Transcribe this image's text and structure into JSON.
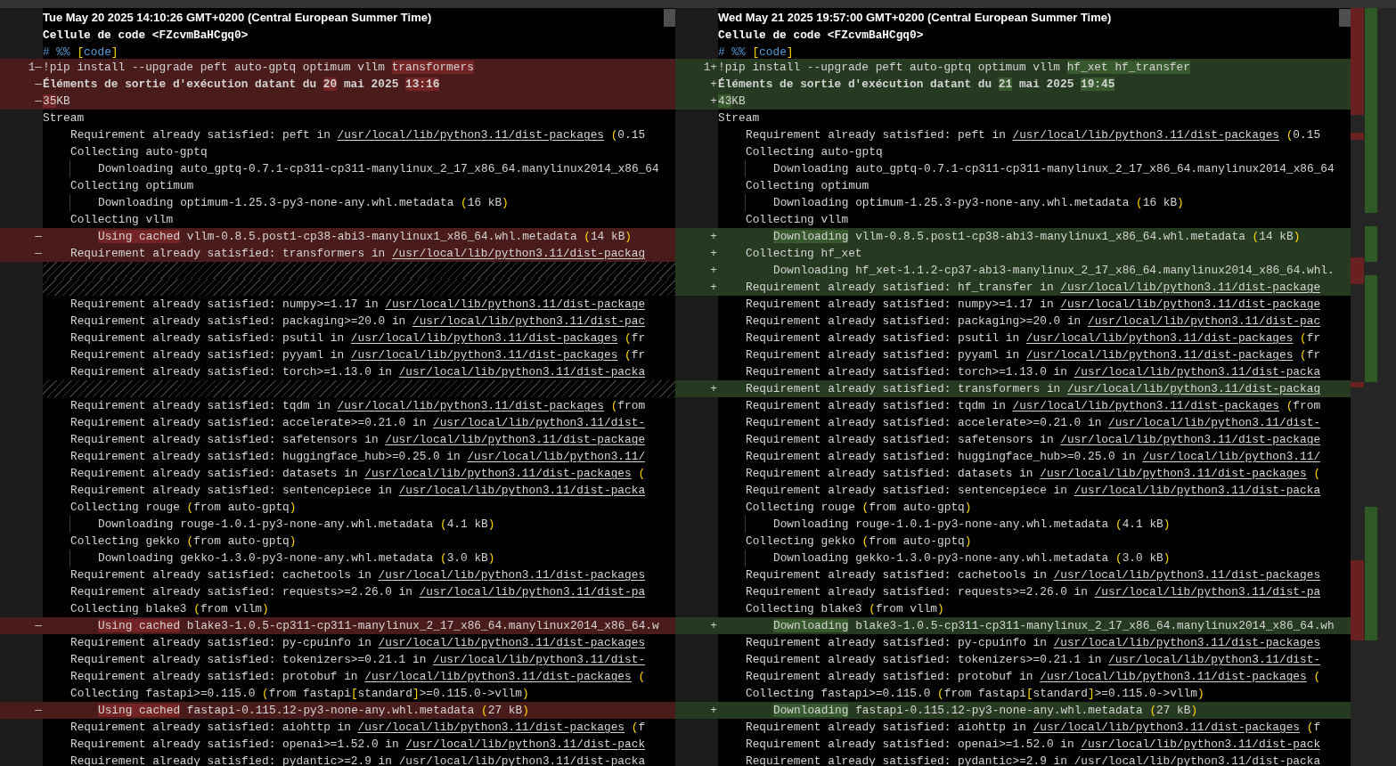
{
  "panes": [
    {
      "timestamp": "Tue May 20 2025 14:10:26 GMT+0200 (Central European Summer Time)",
      "cell_title": "Cellule de code <FZcvmBaHCgq0>",
      "cell_marker": [
        {
          "text": "# %% ",
          "kind": "keyword"
        },
        {
          "text": "[",
          "kind": "punct"
        },
        {
          "text": "code",
          "kind": "keyword"
        },
        {
          "text": "]",
          "kind": "punct"
        }
      ],
      "lines": [
        {
          "kind": "removed",
          "number": "1",
          "sign": "—",
          "segments": [
            {
              "text": "!pip install --upgrade peft auto-gptq optimum vllm "
            },
            {
              "text": "transformers",
              "kind": "changed"
            }
          ]
        },
        {
          "kind": "removed",
          "sign": "—",
          "bold": true,
          "segments": [
            {
              "text": "Éléments de sortie d'exécution datant du "
            },
            {
              "text": "20",
              "kind": "changed"
            },
            {
              "text": " mai 2025 "
            },
            {
              "text": "13:16",
              "kind": "changed"
            }
          ]
        },
        {
          "kind": "removed",
          "sign": "—",
          "segments": [
            {
              "text": "35",
              "kind": "changed"
            },
            {
              "text": "KB"
            }
          ]
        },
        {
          "kind": "context",
          "segments": [
            {
              "text": "Stream"
            }
          ],
          "children": [
            {
              "kind": "context",
              "segments": [
                {
                  "text": "Requirement already satisfied: peft in "
                },
                {
                  "text": "/usr/local/lib/python3.11/dist-packages",
                  "kind": "path"
                },
                {
                  "text": " (",
                  "kind": "punct"
                },
                {
                  "text": "0.15"
                }
              ]
            },
            {
              "kind": "context",
              "segments": [
                {
                  "text": "Collecting auto-gptq"
                }
              ],
              "children": [
                {
                  "kind": "context",
                  "segments": [
                    {
                      "text": "Downloading auto_gptq-0.7.1-cp311-cp311-manylinux_2_17_x86_64.manylinux2014_x86_64"
                    }
                  ]
                }
              ]
            },
            {
              "kind": "context",
              "segments": [
                {
                  "text": "Collecting optimum"
                }
              ],
              "children": [
                {
                  "kind": "context",
                  "segments": [
                    {
                      "text": "Downloading optimum-1.25.3-py3-none-any.whl.metadata "
                    },
                    {
                      "text": "(",
                      "kind": "punct"
                    },
                    {
                      "text": "16 kB"
                    },
                    {
                      "text": ")",
                      "kind": "punct"
                    }
                  ]
                }
              ]
            },
            {
              "kind": "context",
              "segments": [
                {
                  "text": "Collecting vllm"
                }
              ],
              "children": [
                {
                  "kind": "removed",
                  "sign": "—",
                  "segments": [
                    {
                      "text": "Using cached",
                      "kind": "changed"
                    },
                    {
                      "text": " vllm-0.8.5.post1-cp38-abi3-manylinux1_x86_64.whl.metadata "
                    },
                    {
                      "text": "(",
                      "kind": "punct"
                    },
                    {
                      "text": "14 kB"
                    },
                    {
                      "text": ")",
                      "kind": "punct"
                    }
                  ]
                }
              ]
            },
            {
              "kind": "removed",
              "sign": "—",
              "segments": [
                {
                  "text": "Requirement already satisfied: transformers in "
                },
                {
                  "text": "/usr/local/lib/python3.11/dist-packag",
                  "kind": "path"
                }
              ]
            },
            {
              "kind": "filler"
            },
            {
              "kind": "filler"
            },
            {
              "kind": "context",
              "segments": [
                {
                  "text": "Requirement already satisfied: numpy>=1.17 in "
                },
                {
                  "text": "/usr/local/lib/python3.11/dist-package",
                  "kind": "path"
                }
              ]
            },
            {
              "kind": "context",
              "segments": [
                {
                  "text": "Requirement already satisfied: packaging>=20.0 in "
                },
                {
                  "text": "/usr/local/lib/python3.11/dist-pac",
                  "kind": "path"
                }
              ]
            },
            {
              "kind": "context",
              "segments": [
                {
                  "text": "Requirement already satisfied: psutil in "
                },
                {
                  "text": "/usr/local/lib/python3.11/dist-packages",
                  "kind": "path"
                },
                {
                  "text": " (",
                  "kind": "punct"
                },
                {
                  "text": "fr"
                }
              ]
            },
            {
              "kind": "context",
              "segments": [
                {
                  "text": "Requirement already satisfied: pyyaml in "
                },
                {
                  "text": "/usr/local/lib/python3.11/dist-packages",
                  "kind": "path"
                },
                {
                  "text": " (",
                  "kind": "punct"
                },
                {
                  "text": "fr"
                }
              ]
            },
            {
              "kind": "context",
              "segments": [
                {
                  "text": "Requirement already satisfied: torch>=1.13.0 in "
                },
                {
                  "text": "/usr/local/lib/python3.11/dist-packa",
                  "kind": "path"
                }
              ]
            },
            {
              "kind": "filler"
            },
            {
              "kind": "context",
              "segments": [
                {
                  "text": "Requirement already satisfied: tqdm in "
                },
                {
                  "text": "/usr/local/lib/python3.11/dist-packages",
                  "kind": "path"
                },
                {
                  "text": " (",
                  "kind": "punct"
                },
                {
                  "text": "from"
                }
              ]
            },
            {
              "kind": "context",
              "segments": [
                {
                  "text": "Requirement already satisfied: accelerate>=0.21.0 in "
                },
                {
                  "text": "/usr/local/lib/python3.11/dist-",
                  "kind": "path"
                }
              ]
            },
            {
              "kind": "context",
              "segments": [
                {
                  "text": "Requirement already satisfied: safetensors in "
                },
                {
                  "text": "/usr/local/lib/python3.11/dist-package",
                  "kind": "path"
                }
              ]
            },
            {
              "kind": "context",
              "segments": [
                {
                  "text": "Requirement already satisfied: huggingface_hub>=0.25.0 in "
                },
                {
                  "text": "/usr/local/lib/python3.11/",
                  "kind": "path"
                }
              ]
            },
            {
              "kind": "context",
              "segments": [
                {
                  "text": "Requirement already satisfied: datasets in "
                },
                {
                  "text": "/usr/local/lib/python3.11/dist-packages",
                  "kind": "path"
                },
                {
                  "text": " (",
                  "kind": "punct"
                }
              ]
            },
            {
              "kind": "context",
              "segments": [
                {
                  "text": "Requirement already satisfied: sentencepiece in "
                },
                {
                  "text": "/usr/local/lib/python3.11/dist-packa",
                  "kind": "path"
                }
              ]
            },
            {
              "kind": "context",
              "segments": [
                {
                  "text": "Collecting rouge "
                },
                {
                  "text": "(",
                  "kind": "punct"
                },
                {
                  "text": "from auto-gptq"
                },
                {
                  "text": ")",
                  "kind": "punct"
                }
              ],
              "children": [
                {
                  "kind": "context",
                  "segments": [
                    {
                      "text": "Downloading rouge-1.0.1-py3-none-any.whl.metadata "
                    },
                    {
                      "text": "(",
                      "kind": "punct"
                    },
                    {
                      "text": "4.1 kB"
                    },
                    {
                      "text": ")",
                      "kind": "punct"
                    }
                  ]
                }
              ]
            },
            {
              "kind": "context",
              "segments": [
                {
                  "text": "Collecting gekko "
                },
                {
                  "text": "(",
                  "kind": "punct"
                },
                {
                  "text": "from auto-gptq"
                },
                {
                  "text": ")",
                  "kind": "punct"
                }
              ],
              "children": [
                {
                  "kind": "context",
                  "segments": [
                    {
                      "text": "Downloading gekko-1.3.0-py3-none-any.whl.metadata "
                    },
                    {
                      "text": "(",
                      "kind": "punct"
                    },
                    {
                      "text": "3.0 kB"
                    },
                    {
                      "text": ")",
                      "kind": "punct"
                    }
                  ]
                }
              ]
            },
            {
              "kind": "context",
              "segments": [
                {
                  "text": "Requirement already satisfied: cachetools in "
                },
                {
                  "text": "/usr/local/lib/python3.11/dist-packages",
                  "kind": "path"
                }
              ]
            },
            {
              "kind": "context",
              "segments": [
                {
                  "text": "Requirement already satisfied: requests>=2.26.0 in "
                },
                {
                  "text": "/usr/local/lib/python3.11/dist-pa",
                  "kind": "path"
                }
              ]
            },
            {
              "kind": "context",
              "segments": [
                {
                  "text": "Collecting blake3 "
                },
                {
                  "text": "(",
                  "kind": "punct"
                },
                {
                  "text": "from vllm"
                },
                {
                  "text": ")",
                  "kind": "punct"
                }
              ],
              "children": [
                {
                  "kind": "removed",
                  "sign": "—",
                  "segments": [
                    {
                      "text": "Using cached",
                      "kind": "changed"
                    },
                    {
                      "text": " blake3-1.0.5-cp311-cp311-manylinux_2_17_x86_64.manylinux2014_x86_64.w"
                    }
                  ]
                }
              ]
            },
            {
              "kind": "context",
              "segments": [
                {
                  "text": "Requirement already satisfied: py-cpuinfo in "
                },
                {
                  "text": "/usr/local/lib/python3.11/dist-packages",
                  "kind": "path"
                }
              ]
            },
            {
              "kind": "context",
              "segments": [
                {
                  "text": "Requirement already satisfied: tokenizers>=0.21.1 in "
                },
                {
                  "text": "/usr/local/lib/python3.11/dist-",
                  "kind": "path"
                }
              ]
            },
            {
              "kind": "context",
              "segments": [
                {
                  "text": "Requirement already satisfied: protobuf in "
                },
                {
                  "text": "/usr/local/lib/python3.11/dist-packages",
                  "kind": "path"
                },
                {
                  "text": " (",
                  "kind": "punct"
                }
              ]
            },
            {
              "kind": "context",
              "segments": [
                {
                  "text": "Collecting fastapi>=0.115.0 "
                },
                {
                  "text": "(",
                  "kind": "punct"
                },
                {
                  "text": "from fastapi"
                },
                {
                  "text": "[",
                  "kind": "punct"
                },
                {
                  "text": "standard"
                },
                {
                  "text": "]",
                  "kind": "punct"
                },
                {
                  "text": ">=0.115.0->vllm"
                },
                {
                  "text": ")",
                  "kind": "punct"
                }
              ],
              "children": [
                {
                  "kind": "removed",
                  "sign": "—",
                  "segments": [
                    {
                      "text": "Using cached",
                      "kind": "changed"
                    },
                    {
                      "text": " fastapi-0.115.12-py3-none-any.whl.metadata "
                    },
                    {
                      "text": "(",
                      "kind": "punct"
                    },
                    {
                      "text": "27 kB"
                    },
                    {
                      "text": ")",
                      "kind": "punct"
                    }
                  ]
                }
              ]
            },
            {
              "kind": "context",
              "segments": [
                {
                  "text": "Requirement already satisfied: aiohttp in "
                },
                {
                  "text": "/usr/local/lib/python3.11/dist-packages",
                  "kind": "path"
                },
                {
                  "text": " (",
                  "kind": "punct"
                },
                {
                  "text": "f"
                }
              ]
            },
            {
              "kind": "context",
              "segments": [
                {
                  "text": "Requirement already satisfied: openai>=1.52.0 in "
                },
                {
                  "text": "/usr/local/lib/python3.11/dist-pack",
                  "kind": "path"
                }
              ]
            },
            {
              "kind": "context",
              "segments": [
                {
                  "text": "Requirement already satisfied: pydantic>=2.9 in "
                },
                {
                  "text": "/usr/local/lib/python3.11/dist-packa",
                  "kind": "path"
                }
              ]
            }
          ]
        }
      ]
    },
    {
      "timestamp": "Wed May 21 2025 19:57:00 GMT+0200 (Central European Summer Time)",
      "cell_title": "Cellule de code <FZcvmBaHCgq0>",
      "cell_marker": [
        {
          "text": "# %% ",
          "kind": "keyword"
        },
        {
          "text": "[",
          "kind": "punct"
        },
        {
          "text": "code",
          "kind": "keyword"
        },
        {
          "text": "]",
          "kind": "punct"
        }
      ],
      "lines": [
        {
          "kind": "added",
          "number": "1",
          "sign": "+",
          "segments": [
            {
              "text": "!pip install --upgrade peft auto-gptq optimum vllm "
            },
            {
              "text": "hf_xet hf_transfer",
              "kind": "changed"
            }
          ]
        },
        {
          "kind": "added",
          "sign": "+",
          "bold": true,
          "segments": [
            {
              "text": "Éléments de sortie d'exécution datant du "
            },
            {
              "text": "21",
              "kind": "changed"
            },
            {
              "text": " mai 2025 "
            },
            {
              "text": "19:45",
              "kind": "changed"
            }
          ]
        },
        {
          "kind": "added",
          "sign": "+",
          "segments": [
            {
              "text": "43",
              "kind": "changed"
            },
            {
              "text": "KB"
            }
          ]
        },
        {
          "kind": "context",
          "segments": [
            {
              "text": "Stream"
            }
          ],
          "children": [
            {
              "kind": "context",
              "segments": [
                {
                  "text": "Requirement already satisfied: peft in "
                },
                {
                  "text": "/usr/local/lib/python3.11/dist-packages",
                  "kind": "path"
                },
                {
                  "text": " (",
                  "kind": "punct"
                },
                {
                  "text": "0.15"
                }
              ]
            },
            {
              "kind": "context",
              "segments": [
                {
                  "text": "Collecting auto-gptq"
                }
              ],
              "children": [
                {
                  "kind": "context",
                  "segments": [
                    {
                      "text": "Downloading auto_gptq-0.7.1-cp311-cp311-manylinux_2_17_x86_64.manylinux2014_x86_64"
                    }
                  ]
                }
              ]
            },
            {
              "kind": "context",
              "segments": [
                {
                  "text": "Collecting optimum"
                }
              ],
              "children": [
                {
                  "kind": "context",
                  "segments": [
                    {
                      "text": "Downloading optimum-1.25.3-py3-none-any.whl.metadata "
                    },
                    {
                      "text": "(",
                      "kind": "punct"
                    },
                    {
                      "text": "16 kB"
                    },
                    {
                      "text": ")",
                      "kind": "punct"
                    }
                  ]
                }
              ]
            },
            {
              "kind": "context",
              "segments": [
                {
                  "text": "Collecting vllm"
                }
              ],
              "children": [
                {
                  "kind": "added",
                  "sign": "+",
                  "segments": [
                    {
                      "text": "Downloading",
                      "kind": "changed"
                    },
                    {
                      "text": " vllm-0.8.5.post1-cp38-abi3-manylinux1_x86_64.whl.metadata "
                    },
                    {
                      "text": "(",
                      "kind": "punct"
                    },
                    {
                      "text": "14 kB"
                    },
                    {
                      "text": ")",
                      "kind": "punct"
                    }
                  ]
                }
              ]
            },
            {
              "kind": "added",
              "sign": "+",
              "segments": [
                {
                  "text": "Collecting hf_xet"
                }
              ],
              "children": [
                {
                  "kind": "added",
                  "sign": "+",
                  "segments": [
                    {
                      "text": "Downloading hf_xet-1.1.2-cp37-abi3-manylinux_2_17_x86_64.manylinux2014_x86_64.whl."
                    }
                  ]
                }
              ]
            },
            {
              "kind": "added",
              "sign": "+",
              "segments": [
                {
                  "text": "Requirement already satisfied: hf_transfer in "
                },
                {
                  "text": "/usr/local/lib/python3.11/dist-package",
                  "kind": "path"
                }
              ]
            },
            {
              "kind": "context",
              "segments": [
                {
                  "text": "Requirement already satisfied: numpy>=1.17 in "
                },
                {
                  "text": "/usr/local/lib/python3.11/dist-package",
                  "kind": "path"
                }
              ]
            },
            {
              "kind": "context",
              "segments": [
                {
                  "text": "Requirement already satisfied: packaging>=20.0 in "
                },
                {
                  "text": "/usr/local/lib/python3.11/dist-pac",
                  "kind": "path"
                }
              ]
            },
            {
              "kind": "context",
              "segments": [
                {
                  "text": "Requirement already satisfied: psutil in "
                },
                {
                  "text": "/usr/local/lib/python3.11/dist-packages",
                  "kind": "path"
                },
                {
                  "text": " (",
                  "kind": "punct"
                },
                {
                  "text": "fr"
                }
              ]
            },
            {
              "kind": "context",
              "segments": [
                {
                  "text": "Requirement already satisfied: pyyaml in "
                },
                {
                  "text": "/usr/local/lib/python3.11/dist-packages",
                  "kind": "path"
                },
                {
                  "text": " (",
                  "kind": "punct"
                },
                {
                  "text": "fr"
                }
              ]
            },
            {
              "kind": "context",
              "segments": [
                {
                  "text": "Requirement already satisfied: torch>=1.13.0 in "
                },
                {
                  "text": "/usr/local/lib/python3.11/dist-packa",
                  "kind": "path"
                }
              ]
            },
            {
              "kind": "added",
              "sign": "+",
              "segments": [
                {
                  "text": "Requirement already satisfied: transformers in "
                },
                {
                  "text": "/usr/local/lib/python3.11/dist-packag",
                  "kind": "path"
                }
              ]
            },
            {
              "kind": "context",
              "segments": [
                {
                  "text": "Requirement already satisfied: tqdm in "
                },
                {
                  "text": "/usr/local/lib/python3.11/dist-packages",
                  "kind": "path"
                },
                {
                  "text": " (",
                  "kind": "punct"
                },
                {
                  "text": "from"
                }
              ]
            },
            {
              "kind": "context",
              "segments": [
                {
                  "text": "Requirement already satisfied: accelerate>=0.21.0 in "
                },
                {
                  "text": "/usr/local/lib/python3.11/dist-",
                  "kind": "path"
                }
              ]
            },
            {
              "kind": "context",
              "segments": [
                {
                  "text": "Requirement already satisfied: safetensors in "
                },
                {
                  "text": "/usr/local/lib/python3.11/dist-package",
                  "kind": "path"
                }
              ]
            },
            {
              "kind": "context",
              "segments": [
                {
                  "text": "Requirement already satisfied: huggingface_hub>=0.25.0 in "
                },
                {
                  "text": "/usr/local/lib/python3.11/",
                  "kind": "path"
                }
              ]
            },
            {
              "kind": "context",
              "segments": [
                {
                  "text": "Requirement already satisfied: datasets in "
                },
                {
                  "text": "/usr/local/lib/python3.11/dist-packages",
                  "kind": "path"
                },
                {
                  "text": " (",
                  "kind": "punct"
                }
              ]
            },
            {
              "kind": "context",
              "segments": [
                {
                  "text": "Requirement already satisfied: sentencepiece in "
                },
                {
                  "text": "/usr/local/lib/python3.11/dist-packa",
                  "kind": "path"
                }
              ]
            },
            {
              "kind": "context",
              "segments": [
                {
                  "text": "Collecting rouge "
                },
                {
                  "text": "(",
                  "kind": "punct"
                },
                {
                  "text": "from auto-gptq"
                },
                {
                  "text": ")",
                  "kind": "punct"
                }
              ],
              "children": [
                {
                  "kind": "context",
                  "segments": [
                    {
                      "text": "Downloading rouge-1.0.1-py3-none-any.whl.metadata "
                    },
                    {
                      "text": "(",
                      "kind": "punct"
                    },
                    {
                      "text": "4.1 kB"
                    },
                    {
                      "text": ")",
                      "kind": "punct"
                    }
                  ]
                }
              ]
            },
            {
              "kind": "context",
              "segments": [
                {
                  "text": "Collecting gekko "
                },
                {
                  "text": "(",
                  "kind": "punct"
                },
                {
                  "text": "from auto-gptq"
                },
                {
                  "text": ")",
                  "kind": "punct"
                }
              ],
              "children": [
                {
                  "kind": "context",
                  "segments": [
                    {
                      "text": "Downloading gekko-1.3.0-py3-none-any.whl.metadata "
                    },
                    {
                      "text": "(",
                      "kind": "punct"
                    },
                    {
                      "text": "3.0 kB"
                    },
                    {
                      "text": ")",
                      "kind": "punct"
                    }
                  ]
                }
              ]
            },
            {
              "kind": "context",
              "segments": [
                {
                  "text": "Requirement already satisfied: cachetools in "
                },
                {
                  "text": "/usr/local/lib/python3.11/dist-packages",
                  "kind": "path"
                }
              ]
            },
            {
              "kind": "context",
              "segments": [
                {
                  "text": "Requirement already satisfied: requests>=2.26.0 in "
                },
                {
                  "text": "/usr/local/lib/python3.11/dist-pa",
                  "kind": "path"
                }
              ]
            },
            {
              "kind": "context",
              "segments": [
                {
                  "text": "Collecting blake3 "
                },
                {
                  "text": "(",
                  "kind": "punct"
                },
                {
                  "text": "from vllm"
                },
                {
                  "text": ")",
                  "kind": "punct"
                }
              ],
              "children": [
                {
                  "kind": "added",
                  "sign": "+",
                  "segments": [
                    {
                      "text": "Downloading",
                      "kind": "changed"
                    },
                    {
                      "text": " blake3-1.0.5-cp311-cp311-manylinux_2_17_x86_64.manylinux2014_x86_64.wh"
                    }
                  ]
                }
              ]
            },
            {
              "kind": "context",
              "segments": [
                {
                  "text": "Requirement already satisfied: py-cpuinfo in "
                },
                {
                  "text": "/usr/local/lib/python3.11/dist-packages",
                  "kind": "path"
                }
              ]
            },
            {
              "kind": "context",
              "segments": [
                {
                  "text": "Requirement already satisfied: tokenizers>=0.21.1 in "
                },
                {
                  "text": "/usr/local/lib/python3.11/dist-",
                  "kind": "path"
                }
              ]
            },
            {
              "kind": "context",
              "segments": [
                {
                  "text": "Requirement already satisfied: protobuf in "
                },
                {
                  "text": "/usr/local/lib/python3.11/dist-packages",
                  "kind": "path"
                },
                {
                  "text": " (",
                  "kind": "punct"
                }
              ]
            },
            {
              "kind": "context",
              "segments": [
                {
                  "text": "Collecting fastapi>=0.115.0 "
                },
                {
                  "text": "(",
                  "kind": "punct"
                },
                {
                  "text": "from fastapi"
                },
                {
                  "text": "[",
                  "kind": "punct"
                },
                {
                  "text": "standard"
                },
                {
                  "text": "]",
                  "kind": "punct"
                },
                {
                  "text": ">=0.115.0->vllm"
                },
                {
                  "text": ")",
                  "kind": "punct"
                }
              ],
              "children": [
                {
                  "kind": "added",
                  "sign": "+",
                  "segments": [
                    {
                      "text": "Downloading",
                      "kind": "changed"
                    },
                    {
                      "text": " fastapi-0.115.12-py3-none-any.whl.metadata "
                    },
                    {
                      "text": "(",
                      "kind": "punct"
                    },
                    {
                      "text": "27 kB"
                    },
                    {
                      "text": ")",
                      "kind": "punct"
                    }
                  ]
                }
              ]
            },
            {
              "kind": "context",
              "segments": [
                {
                  "text": "Requirement already satisfied: aiohttp in "
                },
                {
                  "text": "/usr/local/lib/python3.11/dist-packages",
                  "kind": "path"
                },
                {
                  "text": " (",
                  "kind": "punct"
                },
                {
                  "text": "f"
                }
              ]
            },
            {
              "kind": "context",
              "segments": [
                {
                  "text": "Requirement already satisfied: openai>=1.52.0 in "
                },
                {
                  "text": "/usr/local/lib/python3.11/dist-pack",
                  "kind": "path"
                }
              ]
            },
            {
              "kind": "context",
              "segments": [
                {
                  "text": "Requirement already satisfied: pydantic>=2.9 in "
                },
                {
                  "text": "/usr/local/lib/python3.11/dist-packa",
                  "kind": "path"
                }
              ]
            }
          ]
        }
      ]
    }
  ]
}
